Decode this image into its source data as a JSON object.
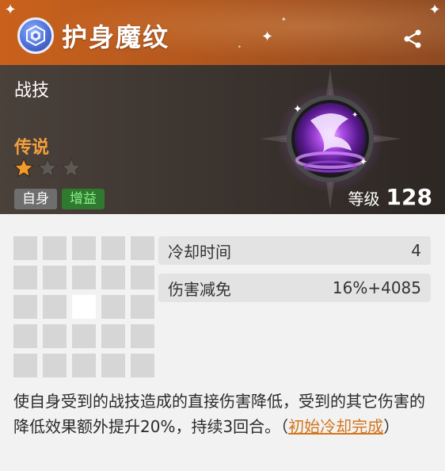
{
  "skill": {
    "title": "护身魔纹",
    "category": "战技",
    "rarity": "传说",
    "stars_filled": 1,
    "stars_total": 3,
    "tags": [
      "自身",
      "增益"
    ],
    "level_label": "等级",
    "level_value": "128"
  },
  "stats": [
    {
      "label": "冷却时间",
      "value": "4"
    },
    {
      "label": "伤害减免",
      "value": "16%+4085"
    }
  ],
  "range_grid": {
    "rows": 5,
    "cols": 5,
    "active_cells": [
      [
        2,
        2
      ]
    ]
  },
  "description": {
    "text": "使自身受到的战技造成的直接伤害降低，受到的其它伤害的降低效果额外提升20%，持续3回合。（",
    "link": "初始冷却完成",
    "tail": "）"
  },
  "icons": {
    "skill": "rune-shield-icon",
    "share": "share-icon",
    "star": "star-icon",
    "emblem": "dark-vortex-emblem"
  },
  "colors": {
    "header": "#b85a1e",
    "rarity": "#f3a03c",
    "buff_tag": "#2f7a2f",
    "link": "#d3761c"
  }
}
